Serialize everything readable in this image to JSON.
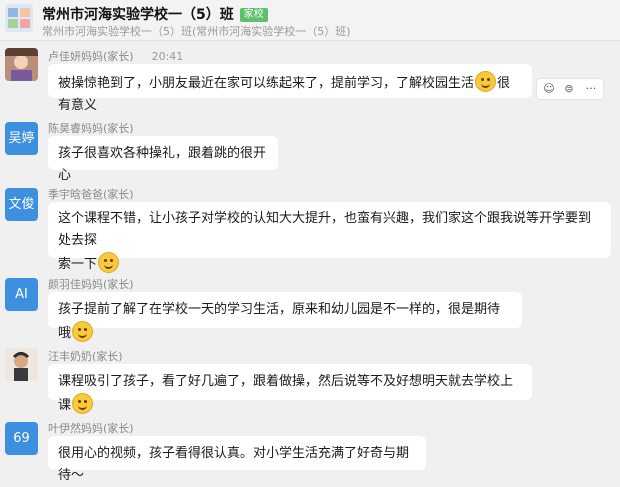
{
  "header": {
    "title": "常州市河海实验学校一（5）班",
    "tag": "家校",
    "subtitle": "常州市河海实验学校一（5）班(常州市河海实验学校一（5）班)"
  },
  "messages": [
    {
      "avatar_text": "",
      "name": "卢佳妍妈妈(家长)",
      "time": "20:41",
      "text": "被操惊艳到了，小朋友最近在家可以练起来了，提前学习，了解校园生活",
      "text_after": "很有意义"
    },
    {
      "avatar_text": "吴婷",
      "name": "陈昊睿妈妈(家长)",
      "time": "",
      "text": "孩子很喜欢各种操礼，跟着跳的很开心",
      "text_after": ""
    },
    {
      "avatar_text": "文俊",
      "name": "季宇晗爸爸(家长)",
      "time": "",
      "text": "这个课程不错，让小孩子对学校的认知大大提升，也蛮有兴趣，我们家这个跟我说等开学要到处去探",
      "text_line2": "索一下"
    },
    {
      "avatar_text": "AI",
      "name": "颜羽佳妈妈(家长)",
      "time": "",
      "text": "孩子提前了解了在学校一天的学习生活，原来和幼儿园是不一样的，很是期待哦",
      "text_after": ""
    },
    {
      "avatar_text": "",
      "name": "汪丰奶奶(家长)",
      "time": "",
      "text": "课程吸引了孩子，看了好几遍了，跟着做操，然后说等不及好想明天就去学校上课",
      "text_after": ""
    },
    {
      "avatar_text": "69",
      "name": "叶伊然妈妈(家长)",
      "time": "",
      "text": "很用心的视频，孩子看得很认真。对小学生活充满了好奇与期待～",
      "text_after": ""
    }
  ],
  "actions": {
    "emoji_icon": "☺",
    "reply_icon": "⊜",
    "more_icon": "···"
  },
  "colors": {
    "avatar_blue": "#3d8fe0",
    "tag_green": "#5fbf6b",
    "bubble": "#ffffff",
    "background": "#f0f0f0"
  }
}
